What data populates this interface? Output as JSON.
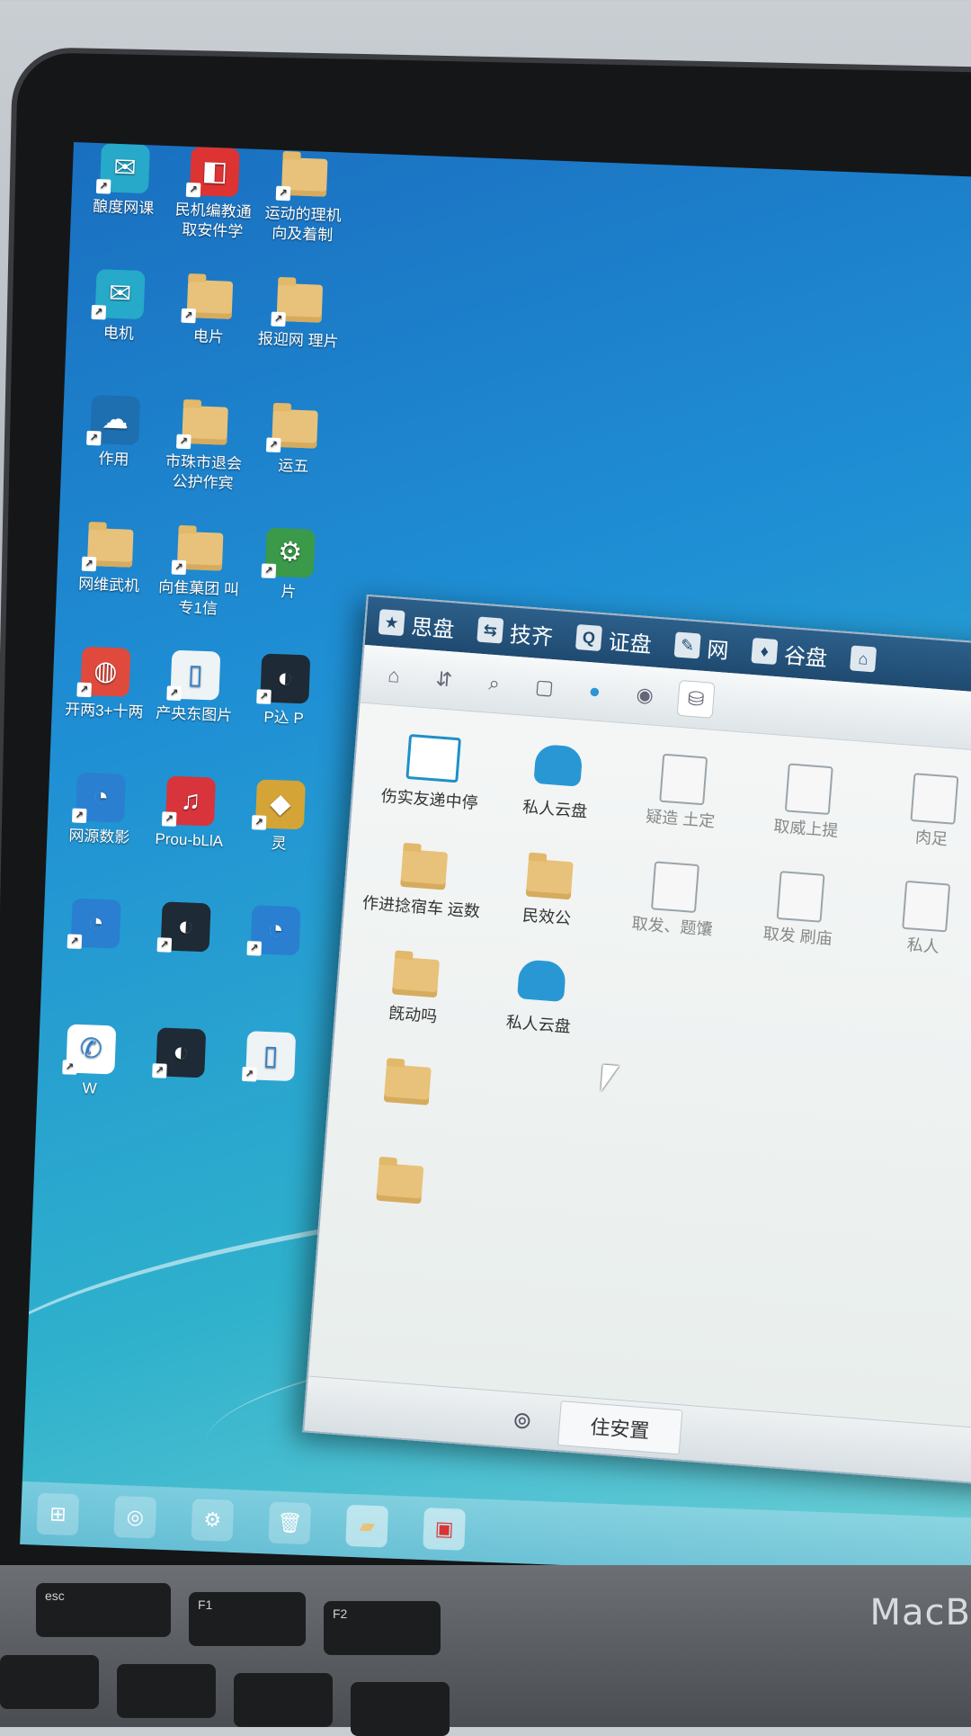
{
  "desktop": {
    "icons": [
      {
        "label": "酿度网课",
        "icon": "mail-icon"
      },
      {
        "label": "民机编教通 取安件学",
        "icon": "app-red-icon"
      },
      {
        "label": "运动的理机 向及着制",
        "icon": "folder-icon"
      },
      {
        "label": "电机",
        "icon": "mail-icon"
      },
      {
        "label": "电片",
        "icon": "folder-icon"
      },
      {
        "label": "报迎网 理片",
        "icon": "folder-icon"
      },
      {
        "label": "作用",
        "icon": "cloud-icon"
      },
      {
        "label": "市珠市退会 公护作宾",
        "icon": "folder-icon"
      },
      {
        "label": "运五",
        "icon": "folder-icon"
      },
      {
        "label": "网维武机",
        "icon": "folder-icon"
      },
      {
        "label": "向隹菓团 叫专1信",
        "icon": "folder-icon"
      },
      {
        "label": "片",
        "icon": "app-green-icon"
      },
      {
        "label": "开两3+十两",
        "icon": "chrome-icon"
      },
      {
        "label": "产央东图片",
        "icon": "document-icon"
      },
      {
        "label": "P込 P",
        "icon": "app-dark-icon"
      },
      {
        "label": "网源数影",
        "icon": "app-blue-icon"
      },
      {
        "label": "Prou-bLlA",
        "icon": "app-music-icon"
      },
      {
        "label": "灵",
        "icon": "app-yellow-icon"
      },
      {
        "label": "",
        "icon": "app-blue-icon"
      },
      {
        "label": "",
        "icon": "app-dark-icon"
      },
      {
        "label": "",
        "icon": "app-blue-icon"
      },
      {
        "label": "W",
        "icon": "chat-icon"
      },
      {
        "label": "",
        "icon": "app-dark-icon"
      },
      {
        "label": "",
        "icon": "document-icon"
      }
    ]
  },
  "window": {
    "tabs": [
      "思盘",
      "技齐",
      "证盘",
      "网",
      "谷盘",
      ""
    ],
    "toolbar_icons": [
      "home-icon",
      "sort-icon",
      "search-icon",
      "document-icon",
      "cloud-icon",
      "disc-icon",
      "drive-icon"
    ],
    "items": [
      {
        "label": "伤实友递中停",
        "icon": "briefcase-icon",
        "faded": false
      },
      {
        "label": "私人云盘",
        "icon": "cloud-icon",
        "faded": false
      },
      {
        "label": "疑造 土定",
        "icon": "document-icon",
        "faded": true
      },
      {
        "label": "取威上提",
        "icon": "user-icon",
        "faded": true
      },
      {
        "label": "肉足",
        "icon": "user-icon",
        "faded": true
      },
      {
        "label": "作进捻宿车 运数",
        "icon": "folder-icon",
        "faded": false
      },
      {
        "label": "民效公",
        "icon": "folder-icon",
        "faded": false
      },
      {
        "label": "取发、题馕",
        "icon": "document-icon",
        "faded": true
      },
      {
        "label": "取发 刷庙",
        "icon": "document-icon",
        "faded": true
      },
      {
        "label": "私人",
        "icon": "document-icon",
        "faded": true
      },
      {
        "label": "旣动吗",
        "icon": "folder-icon",
        "faded": false
      },
      {
        "label": "私人云盘",
        "icon": "cloud-icon",
        "faded": false
      },
      {
        "label": "",
        "icon": "folder-icon",
        "faded": false
      },
      {
        "label": "",
        "icon": "folder-icon",
        "faded": false
      }
    ],
    "status_button": "住安置"
  },
  "taskbar": {
    "items": [
      "start-icon",
      "browser-icon",
      "settings-icon",
      "trash-icon",
      "folder-icon",
      "app-red-icon"
    ]
  },
  "device": {
    "brand": "MacB",
    "keys": [
      "esc",
      "F1",
      "F2"
    ]
  }
}
